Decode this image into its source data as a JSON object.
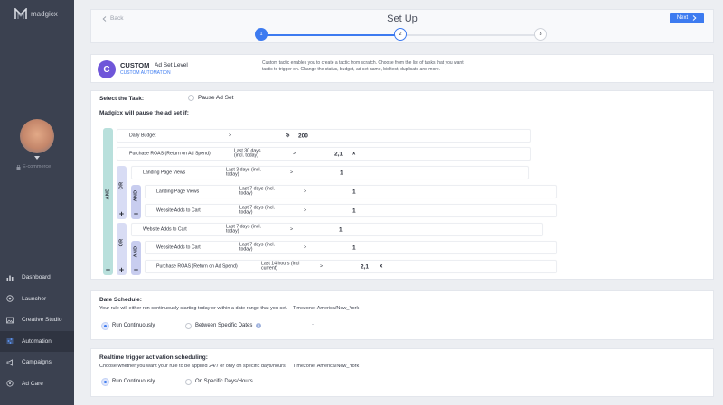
{
  "app": {
    "name": "madgicx"
  },
  "sidebar": {
    "account_label": "E-commerce",
    "items": [
      {
        "label": "Dashboard",
        "icon": "bar-chart-icon"
      },
      {
        "label": "Launcher",
        "icon": "target-icon"
      },
      {
        "label": "Creative Studio",
        "icon": "image-icon"
      },
      {
        "label": "Automation",
        "icon": "sliders-icon",
        "active": true
      },
      {
        "label": "Campaigns",
        "icon": "megaphone-icon"
      },
      {
        "label": "Ad Care",
        "icon": "shield-icon"
      }
    ]
  },
  "header": {
    "back_label": "Back",
    "title": "Set Up",
    "steps": [
      "1",
      "2",
      "3"
    ],
    "next_label": "Next",
    "accent": "#3d7bf0"
  },
  "tactic": {
    "icon_letter": "C",
    "name": "CUSTOM",
    "level": "Ad Set Level",
    "subtitle": "CUSTOM AUTOMATION",
    "description": "Custom tactic enables you to create a tactic from scratch. Choose from the list of tasks that you want tactic to trigger on. Change the status, budget, ad set name, bid test, duplicate and more."
  },
  "task": {
    "label": "Select the Task:",
    "option": "Pause Ad Set",
    "intro": "Madgicx will pause the ad set if:",
    "and_label": "AND",
    "or_label": "OR",
    "plus": "+",
    "conditions": {
      "c1": {
        "metric": "Daily Budget",
        "op": ">",
        "currency": "$",
        "value": "200"
      },
      "c2": {
        "metric": "Purchase ROAS (Return on Ad Spend)",
        "period": "Last 30 days (incl. today)",
        "op": ">",
        "value": "2,1",
        "unit": "x"
      },
      "c3": {
        "metric": "Landing Page Views",
        "period": "Last 3 days (incl. today)",
        "op": ">",
        "value": "1"
      },
      "c4": {
        "metric": "Landing Page Views",
        "period": "Last 7 days (incl. today)",
        "op": ">",
        "value": "1"
      },
      "c5": {
        "metric": "Website Adds to Cart",
        "period": "Last 7 days (incl. today)",
        "op": ">",
        "value": "1"
      },
      "c6": {
        "metric": "Website Adds to Cart",
        "period": "Last 7 days (incl. today)",
        "op": ">",
        "value": "1"
      },
      "c7": {
        "metric": "Website Adds to Cart",
        "period": "Last 7 days (incl. today)",
        "op": ">",
        "value": "1"
      },
      "c8": {
        "metric": "Purchase ROAS (Return on Ad Spend)",
        "period": "Last 14 hours (incl current)",
        "op": ">",
        "value": "2,1",
        "unit": "x"
      }
    }
  },
  "date_schedule": {
    "title": "Date Schedule:",
    "description": "Your rule will either run continuously starting today or within a date range that you set.",
    "timezone": "Timezone: America/New_York",
    "option_continuous": "Run Continuously",
    "option_dates": "Between Specific Dates",
    "dates_value": "-"
  },
  "realtime": {
    "title": "Realtime trigger activation scheduling:",
    "description": "Choose whether you want your rule to be applied 24/7 or only on specific days/hours",
    "timezone": "Timezone: America/New_York",
    "option_continuous": "Run Continuously",
    "option_specific": "On Specific Days/Hours"
  }
}
